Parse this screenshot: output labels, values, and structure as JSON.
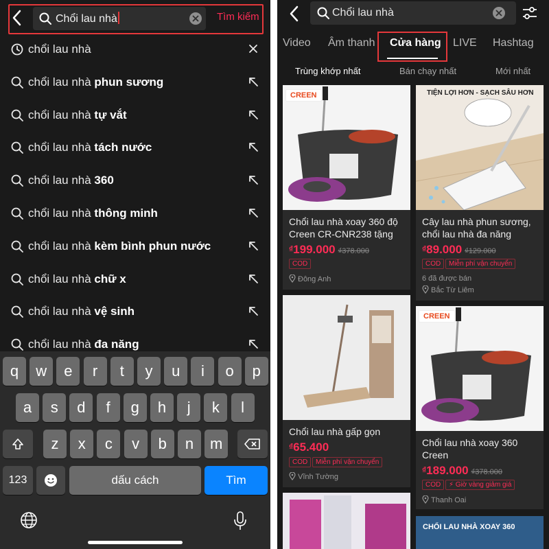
{
  "left": {
    "search_value": "Chổi lau nhà",
    "search_button": "Tìm kiếm",
    "suggestions": [
      {
        "base": "chổi lau nhà",
        "bold": "",
        "type": "history"
      },
      {
        "base": "chổi lau nhà ",
        "bold": "phun sương",
        "type": "suggest"
      },
      {
        "base": "chổi lau nhà ",
        "bold": "tự vắt",
        "type": "suggest"
      },
      {
        "base": "chổi lau nhà ",
        "bold": "tách nước",
        "type": "suggest"
      },
      {
        "base": "chổi lau nhà ",
        "bold": "360",
        "type": "suggest"
      },
      {
        "base": "chổi lau nhà ",
        "bold": "thông minh",
        "type": "suggest"
      },
      {
        "base": "chổi lau nhà ",
        "bold": "kèm bình phun nước",
        "type": "suggest"
      },
      {
        "base": "chổi lau nhà ",
        "bold": "chữ x",
        "type": "suggest"
      },
      {
        "base": "chổi lau nhà ",
        "bold": "vệ sinh",
        "type": "suggest"
      },
      {
        "base": "chổi lau nhà ",
        "bold": "đa năng",
        "type": "suggest"
      }
    ],
    "keyboard": {
      "row1": [
        "q",
        "w",
        "e",
        "r",
        "t",
        "y",
        "u",
        "i",
        "o",
        "p"
      ],
      "row2": [
        "a",
        "s",
        "d",
        "f",
        "g",
        "h",
        "j",
        "k",
        "l"
      ],
      "row3": [
        "z",
        "x",
        "c",
        "v",
        "b",
        "n",
        "m"
      ],
      "numbers_key": "123",
      "space_key": "dấu cách",
      "return_key": "Tìm"
    }
  },
  "right": {
    "search_value": "Chổi lau nhà",
    "tabs": [
      "Video",
      "Âm thanh",
      "Cửa hàng",
      "LIVE",
      "Hashtag"
    ],
    "active_tab": "Cửa hàng",
    "sort_options": [
      "Trùng khớp nhất",
      "Bán chạy nhất",
      "Mới nhất"
    ],
    "products": [
      {
        "name": "Chổi lau nhà xoay 360 độ Creen CR-CNR238 tặng t...",
        "currency": "₫",
        "price": "199.000",
        "old_price": "₫378.000",
        "tags": [
          "COD"
        ],
        "sold": "",
        "location": "Đông Anh",
        "badge": "CREEN",
        "image_text": ""
      },
      {
        "name": "Cây lau nhà phun sương, chổi lau nhà đa năng",
        "currency": "₫",
        "price": "89.000",
        "old_price": "₫129.000",
        "tags": [
          "COD",
          "Miễn phí vận chuyển"
        ],
        "sold": "6 đã được bán",
        "location": "Bắc Từ Liêm",
        "badge": "",
        "image_text": "TIỆN LỢI HƠN - SẠCH SÂU HƠN"
      },
      {
        "name": "Chổi lau nhà gấp gọn",
        "currency": "₫",
        "price": "65.400",
        "old_price": "",
        "tags": [
          "COD",
          "Miễn phí vận chuyển"
        ],
        "sold": "",
        "location": "Vĩnh Tường",
        "badge": "",
        "image_text": ""
      },
      {
        "name": "Chổi lau nhà xoay 360 Creen",
        "currency": "₫",
        "price": "189.000",
        "old_price": "₫378.000",
        "tags": [
          "COD",
          "⚡ Giờ vàng giảm giá"
        ],
        "sold": "",
        "location": "Thanh Oai",
        "badge": "CREEN",
        "image_text": ""
      }
    ],
    "bottom_banner_text": "CHỔI LAU NHÀ XOAY 360"
  },
  "colors": {
    "accent": "#fe2c55",
    "highlight_box": "#e5383b",
    "keyboard_blue": "#0a84ff",
    "background": "#1a1a1a"
  }
}
